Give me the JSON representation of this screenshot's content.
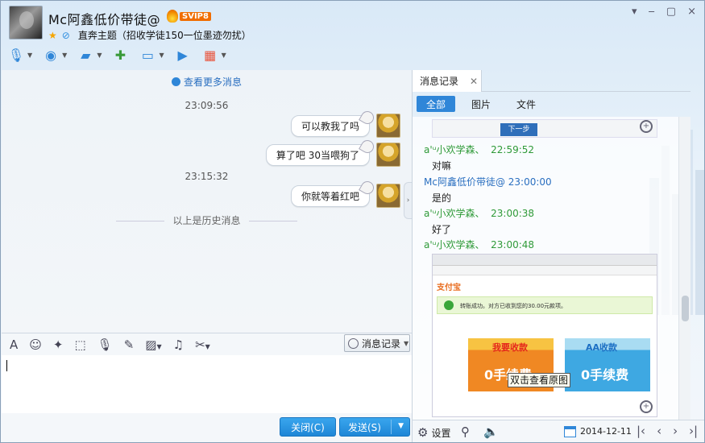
{
  "header": {
    "nickname": "Mc阿鑫低价带徒@",
    "svip_badge": "SVIP8",
    "signature": "直奔主题（招收学徒150一位墨迹勿扰）"
  },
  "window_controls": [
    "▾",
    "▢",
    "×"
  ],
  "toolbar": [
    {
      "name": "voice-call-icon",
      "glyph": "🎤"
    },
    {
      "name": "video-call-icon",
      "glyph": "◉"
    },
    {
      "name": "file-transfer-icon",
      "glyph": "📁"
    },
    {
      "name": "create-discussion-icon",
      "glyph": "💬"
    },
    {
      "name": "remote-desktop-icon",
      "glyph": "🖥"
    },
    {
      "name": "screen-share-icon",
      "glyph": "▶"
    },
    {
      "name": "apps-icon",
      "glyph": "▦"
    }
  ],
  "chat": {
    "view_more": "查看更多消息",
    "messages": [
      {
        "time": "23:09:56"
      },
      {
        "text": "可以教我了吗"
      },
      {
        "text": "算了吧    30当喂狗了"
      },
      {
        "time": "23:15:32"
      },
      {
        "text": "你就等着红吧"
      }
    ],
    "history_divider": "以上是历史消息"
  },
  "editor_toolbar": {
    "icons": [
      "font-icon",
      "emoji-icon",
      "magic-icon",
      "screenshot-icon",
      "voice-msg-icon",
      "doodle-icon",
      "image-icon",
      "music-icon",
      "scissors-icon"
    ],
    "msg_record_label": "消息记录"
  },
  "buttons": {
    "close": "关闭(C)",
    "send": "发送(S)"
  },
  "history_panel": {
    "tab_title": "消息记录",
    "filters": [
      "全部",
      "图片",
      "文件"
    ],
    "snap_top_button": "下一步",
    "entries": [
      {
        "sender": "a'ᵘ小欢学森、",
        "time": "22:59:52",
        "text": "对嘛"
      },
      {
        "sender": "Mc阿鑫低价带徒@",
        "time": "23:00:00",
        "text": "是的"
      },
      {
        "sender": "a'ᵘ小欢学森、",
        "time": "23:00:38",
        "text": "好了"
      },
      {
        "sender": "a'ᵘ小欢学森、",
        "time": "23:00:48",
        "text": ""
      }
    ],
    "tooltip": "双击查看原图",
    "snapshot": {
      "logo": "支付宝",
      "success_text": "转账成功。对方已收到您的30.00元款项。",
      "promo_a_title": "我要收款",
      "promo_a_main": "0手续费",
      "promo_b_title": "AA收款",
      "promo_b_main": "0手续费"
    }
  },
  "bottom_bar": {
    "settings": "设置",
    "date": "2014-12-11"
  }
}
